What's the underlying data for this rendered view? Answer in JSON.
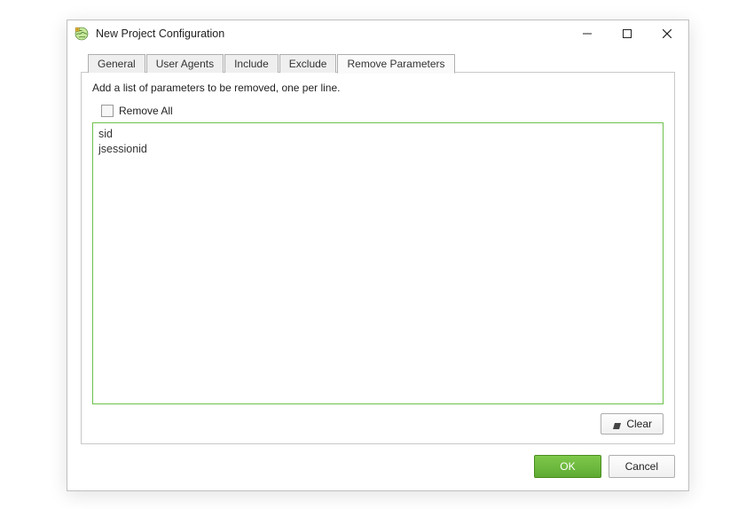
{
  "window": {
    "title": "New Project Configuration"
  },
  "tabs": [
    {
      "label": "General",
      "active": false
    },
    {
      "label": "User Agents",
      "active": false
    },
    {
      "label": "Include",
      "active": false
    },
    {
      "label": "Exclude",
      "active": false
    },
    {
      "label": "Remove Parameters",
      "active": true
    }
  ],
  "panel": {
    "description": "Add a list of parameters to be removed, one per line.",
    "removeAll": {
      "label": "Remove All",
      "checked": false
    },
    "textarea_value": "sid\njsessionid",
    "clear_label": "Clear"
  },
  "footer": {
    "ok_label": "OK",
    "cancel_label": "Cancel"
  }
}
